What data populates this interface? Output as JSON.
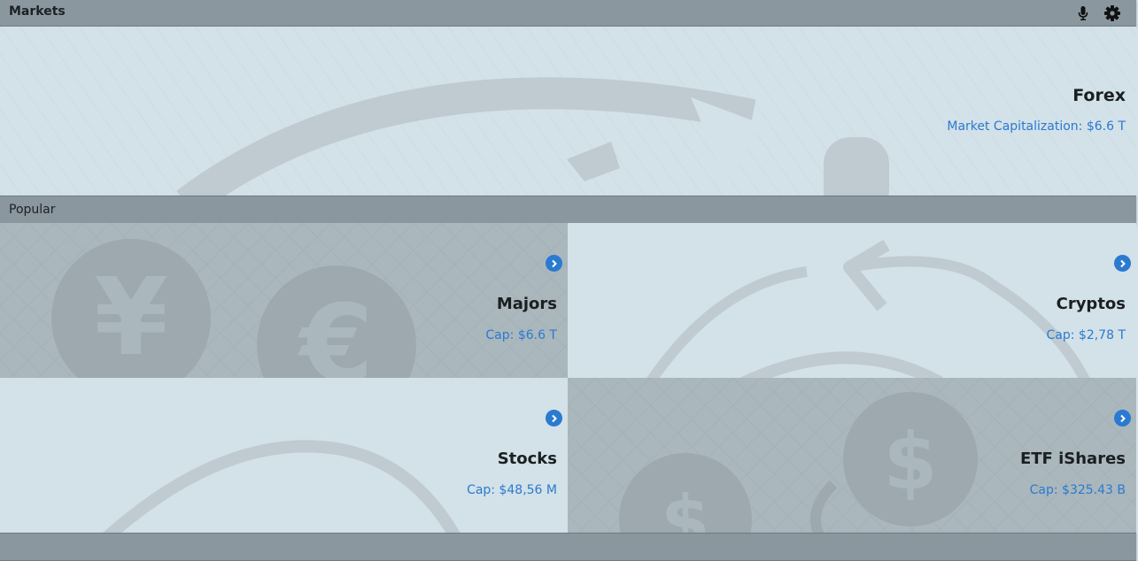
{
  "header": {
    "title": "Markets",
    "icons": [
      "microphone-icon",
      "gear-icon"
    ]
  },
  "hero": {
    "title": "Forex",
    "market_cap": "Market Capitalization: $6.6 T"
  },
  "popular": {
    "title": "Popular",
    "tiles": [
      {
        "title": "Majors",
        "cap": "Cap: $6.6 T"
      },
      {
        "title": "Cryptos",
        "cap": "Cap: $2,78 T"
      },
      {
        "title": "Stocks",
        "cap": "Cap: $48,56 M"
      },
      {
        "title": "ETF iShares",
        "cap": "Cap: $325.43 B"
      }
    ]
  },
  "colors": {
    "bar": "#8a979e",
    "light_panel": "#d3e1e8",
    "dark_panel": "#aab7bd",
    "accent": "#2a7ad0"
  }
}
